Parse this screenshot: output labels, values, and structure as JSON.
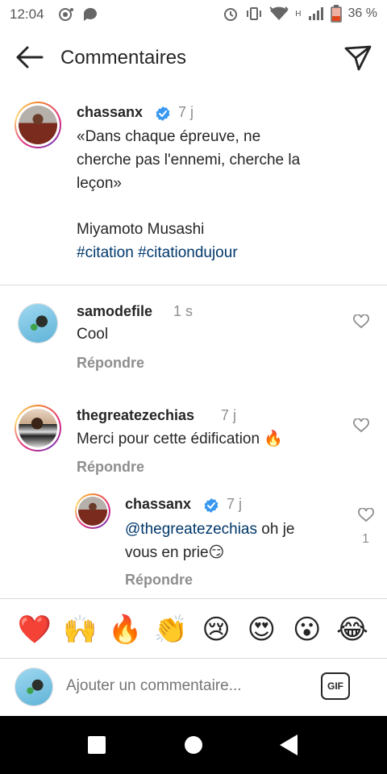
{
  "status_bar": {
    "time": "12:04",
    "network": "H",
    "battery": "36 %"
  },
  "header": {
    "title": "Commentaires"
  },
  "caption": {
    "username": "chassanx",
    "time": "7 j",
    "line1": "«Dans chaque épreuve, ne",
    "line2": "cherche pas l'ennemi, cherche la",
    "line3": "leçon»",
    "author": "Miyamoto Musashi",
    "hashtag1": "#citation",
    "hashtag2": "#citationdujour"
  },
  "comments": [
    {
      "username": "samodefile",
      "time": "1 s",
      "text": "Cool",
      "reply": "Répondre"
    },
    {
      "username": "thegreatezechias",
      "time": "7 j",
      "text": "Merci pour cette édification",
      "emoji": "🔥",
      "reply": "Répondre"
    }
  ],
  "reply_comment": {
    "username": "chassanx",
    "time": "7 j",
    "mention": "@thegreatezechias",
    "text_after_mention": " oh je",
    "line2": "vous en prie",
    "emoji": "😏",
    "reply": "Répondre",
    "likes": "1"
  },
  "emoji_bar": [
    "❤️",
    "🙌",
    "🔥",
    "👏",
    "😢",
    "😍",
    "😮",
    "😂"
  ],
  "input": {
    "placeholder": "Ajouter un commentaire...",
    "gif_label": "GIF"
  },
  "colors": {
    "link": "#00376b",
    "muted": "#8e8e8e",
    "verified": "#3897f0"
  }
}
